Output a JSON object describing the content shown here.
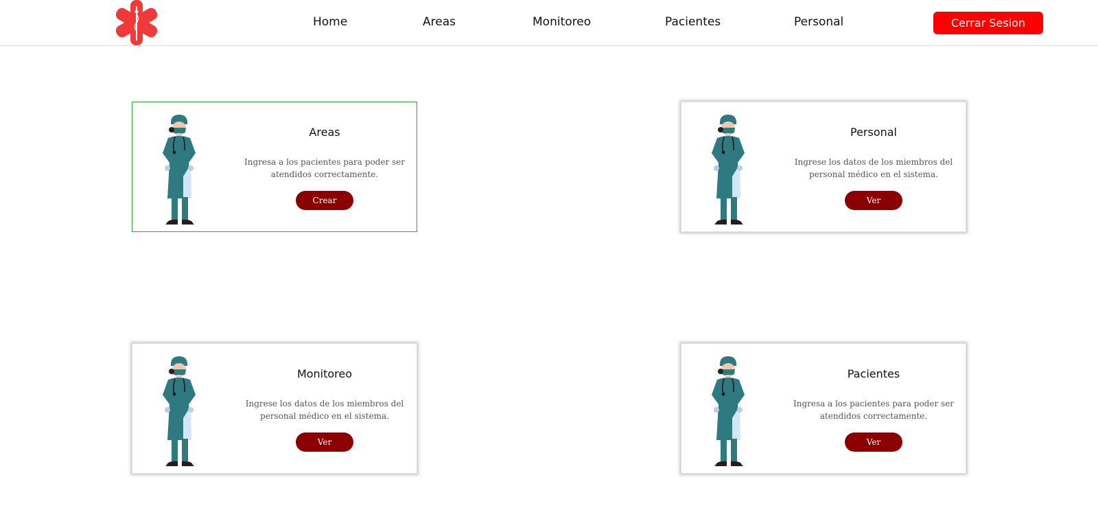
{
  "nav": {
    "items": [
      {
        "label": "Home"
      },
      {
        "label": "Areas"
      },
      {
        "label": "Monitoreo"
      },
      {
        "label": "Pacientes"
      },
      {
        "label": "Personal"
      }
    ],
    "logout_label": "Cerrar Sesion"
  },
  "logo": {
    "icon": "medical-star-icon",
    "color": "#f03a3a"
  },
  "cards": [
    {
      "title": "Areas",
      "description": "Ingresa a los pacientes para poder ser atendidos correctamente.",
      "button": "Crear"
    },
    {
      "title": "Personal",
      "description": "Ingrese los datos de los miembros del personal médico en el sistema.",
      "button": "Ver"
    },
    {
      "title": "Monitoreo",
      "description": "Ingrese los datos de los miembros del personal médico en el sistema.",
      "button": "Ver"
    },
    {
      "title": "Pacientes",
      "description": "Ingresa a los pacientes para poder ser atendidos correctamente.",
      "button": "Ver"
    }
  ],
  "colors": {
    "accent": "#ff0000",
    "card_button": "#8b0000",
    "scrubs": "#2f7a80",
    "active_border": "#33a033"
  }
}
